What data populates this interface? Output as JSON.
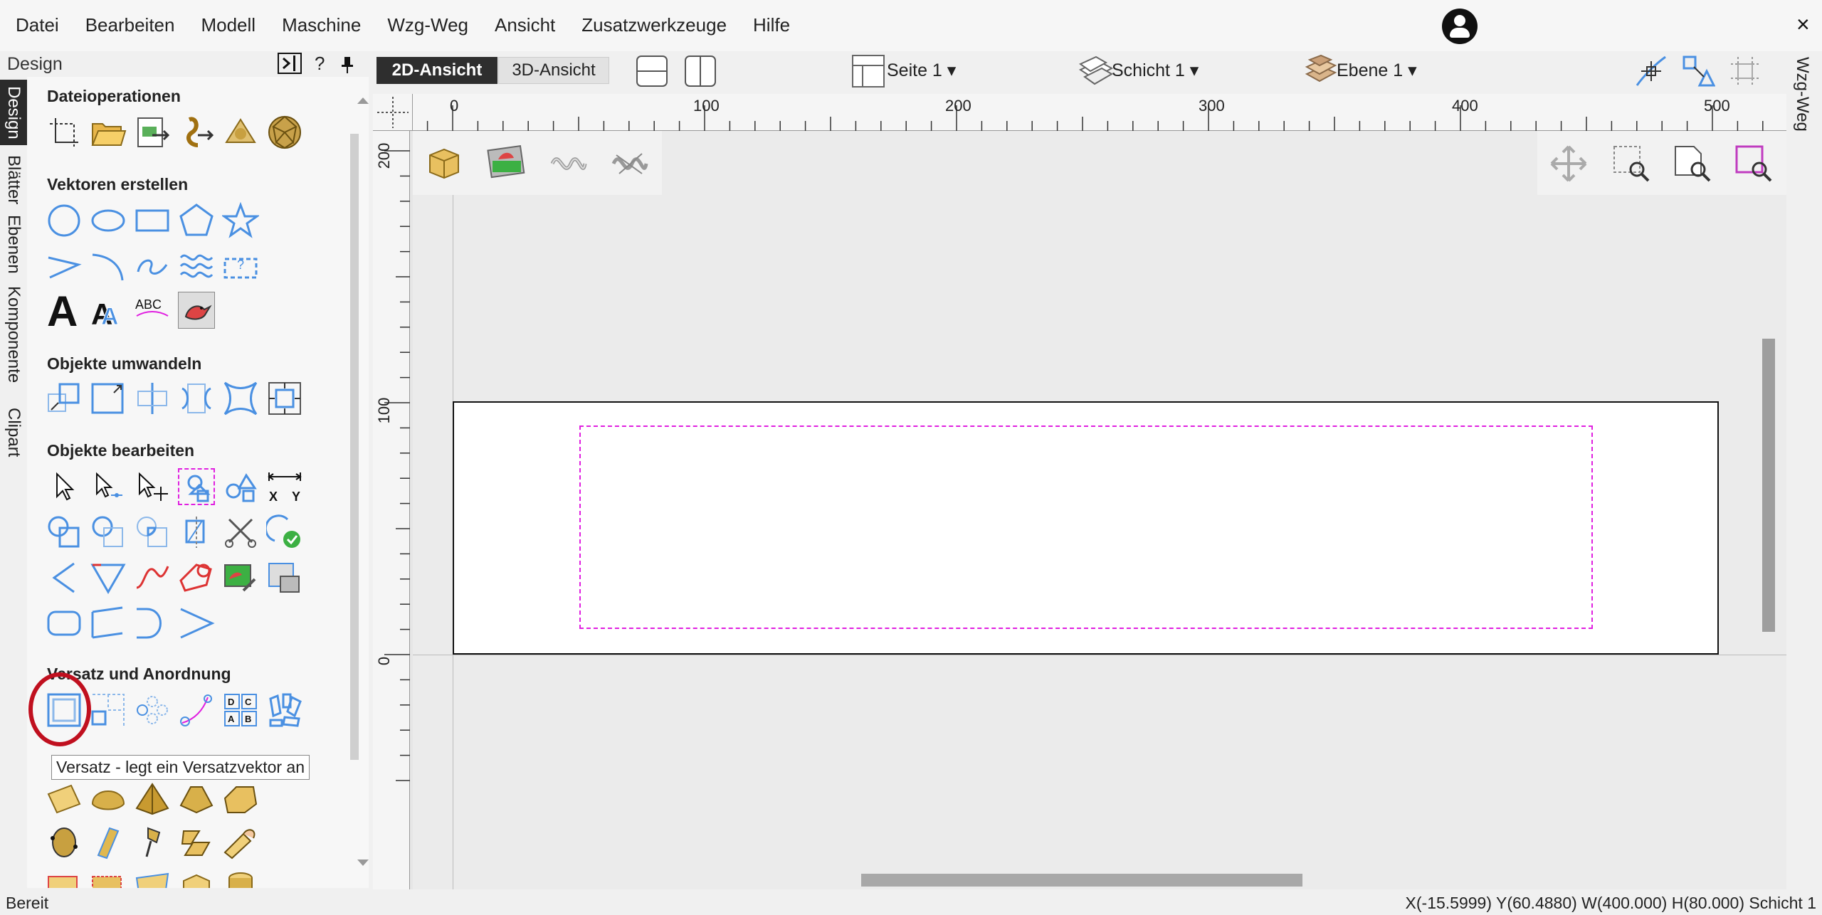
{
  "menu": [
    "Datei",
    "Bearbeiten",
    "Modell",
    "Maschine",
    "Wzg-Weg",
    "Ansicht",
    "Zusatzwerkzeuge",
    "Hilfe"
  ],
  "window": {
    "close_label": "×"
  },
  "panel": {
    "title": "Design",
    "pin_label": "?",
    "side_tabs": [
      "Design",
      "Blätter",
      "Ebenen",
      "Komponente",
      "Clipart"
    ],
    "sections": {
      "file_ops": "Dateioperationen",
      "create_vectors": "Vektoren erstellen",
      "transform": "Objekte umwandeln",
      "edit": "Objekte  bearbeiten",
      "offset": "Versatz und Anordnung"
    },
    "text_icons": {
      "big_a": "A",
      "abc": "ABC",
      "x": "X",
      "y": "Y"
    },
    "tooltip": "Versatz - legt ein Versatzvektor an"
  },
  "toolbar": {
    "view_2d": "2D-Ansicht",
    "view_3d": "3D-Ansicht",
    "page": "Seite 1",
    "layer": "Schicht 1",
    "level": "Ebene 1"
  },
  "right_tab": "Wzg-Weg",
  "rulers": {
    "top_ticks": [
      "0",
      "100",
      "200",
      "300",
      "400",
      "500"
    ],
    "left_ticks": [
      "200",
      "100",
      "0"
    ]
  },
  "status": {
    "left": "Bereit",
    "right": "X(-15.5999) Y(60.4880)    W(400.000) H(80.000) Schicht 1"
  },
  "colors": {
    "accent_blue": "#4a90e2",
    "vector_magenta": "#e020e0",
    "highlight_red": "#c0101f"
  }
}
